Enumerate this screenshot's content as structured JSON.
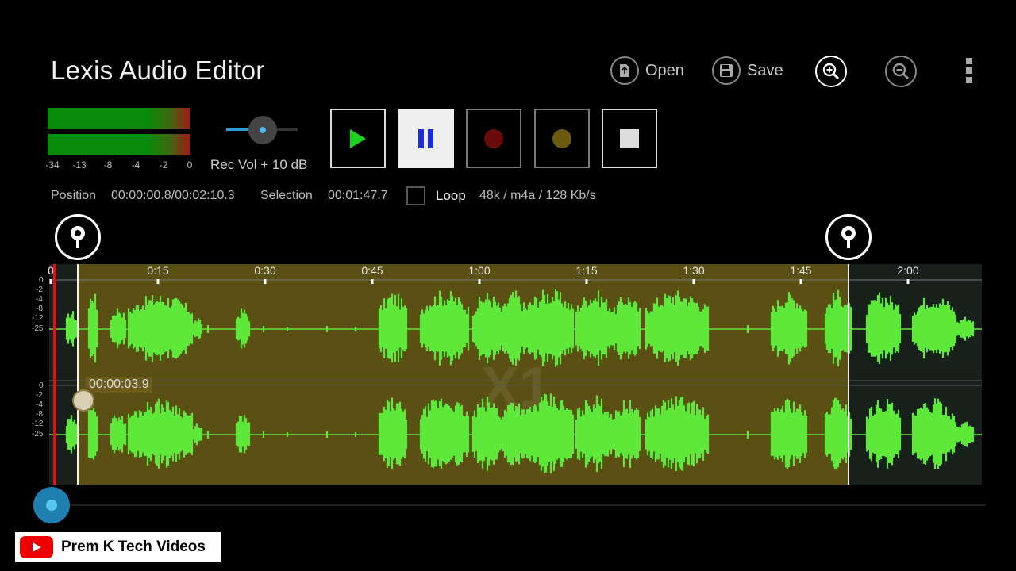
{
  "app": {
    "title": "Lexis Audio Editor"
  },
  "toolbar": {
    "open_label": "Open",
    "save_label": "Save"
  },
  "meter": {
    "scale": [
      "-34",
      "-13",
      "-8",
      "-4",
      "-2",
      "0"
    ]
  },
  "rec_vol": {
    "label": "Rec Vol + 10 dB"
  },
  "info": {
    "position_label": "Position",
    "position_value": "00:00:00.8/00:02:10.3",
    "selection_label": "Selection",
    "selection_value": "00:01:47.7",
    "loop_label": "Loop",
    "format": "48k / m4a / 128 Kb/s"
  },
  "timeline": {
    "ticks": [
      "0",
      "0:15",
      "0:30",
      "0:45",
      "1:00",
      "1:15",
      "1:30",
      "1:45",
      "2:00"
    ]
  },
  "db_scale": [
    "0",
    "-2",
    "-4",
    "-8",
    "-12",
    "-25"
  ],
  "cursor": {
    "time": "00:00:03.9"
  },
  "watermark": "X1",
  "badge": {
    "label": "Prem K Tech Videos"
  },
  "colors": {
    "wave": "#5ee83a",
    "selection": "#766212",
    "position": "#e01414"
  }
}
